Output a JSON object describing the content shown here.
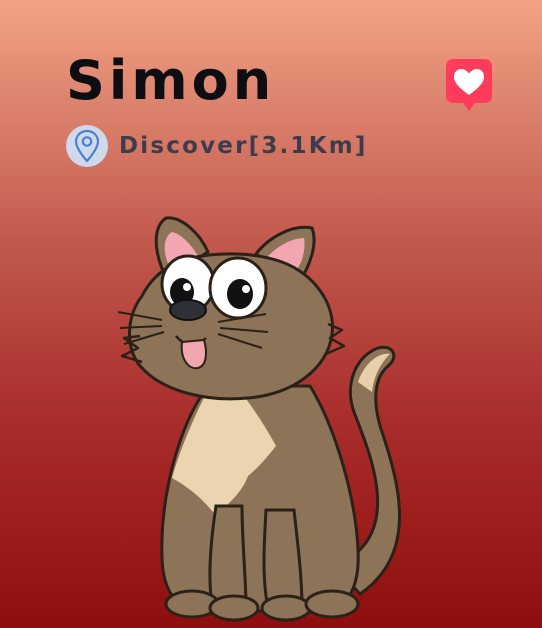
{
  "pet": {
    "name": "Simon",
    "location_label": "Discover[3.1Km]"
  },
  "icons": {
    "location": "map-pin-icon",
    "favorite": "heart-icon"
  },
  "colors": {
    "gradient_top": "#f2a384",
    "gradient_bottom": "#8e0e0e",
    "favorite_badge": "#ff3b5c",
    "pin_badge_bg": "#cfd9ec",
    "pin_stroke": "#4a7fd4",
    "name_text": "#0d0d12",
    "location_text": "#3c3c4c"
  }
}
